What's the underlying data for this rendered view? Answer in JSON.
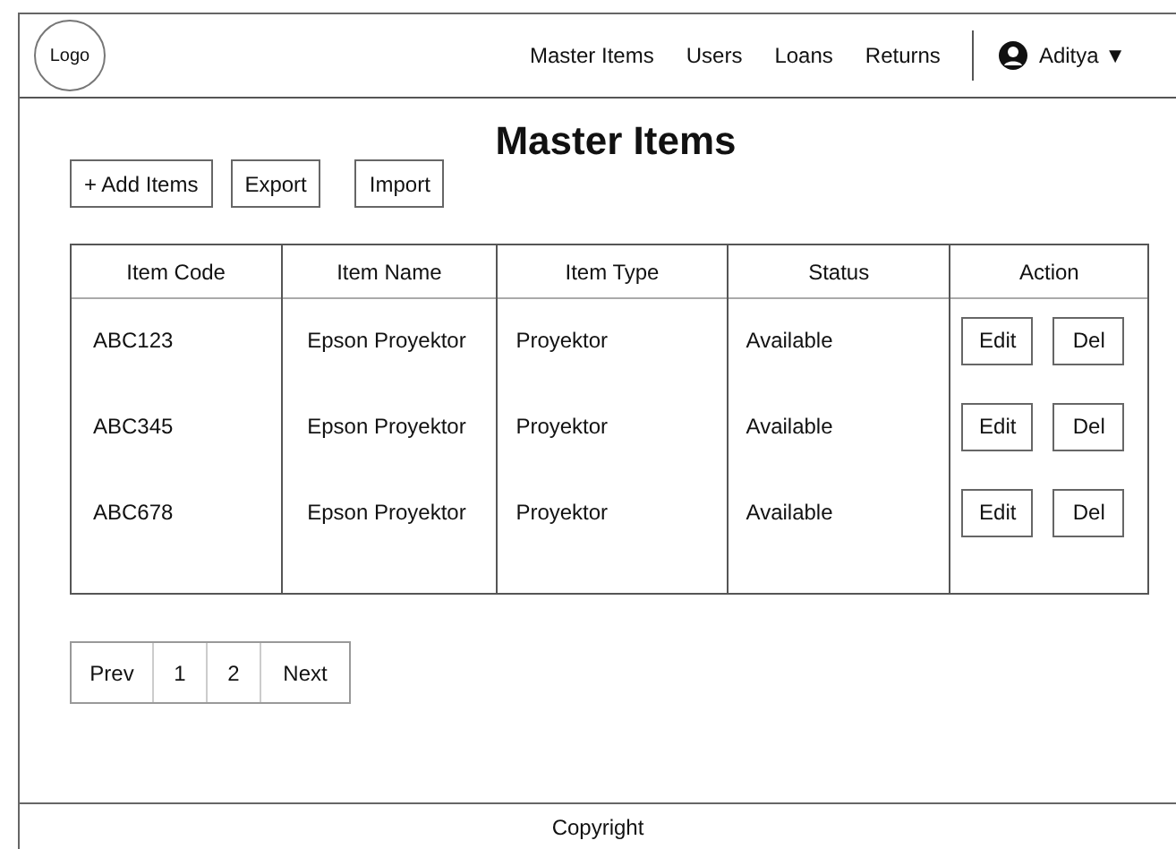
{
  "header": {
    "logo": "Logo",
    "nav": [
      "Master Items",
      "Users",
      "Loans",
      "Returns"
    ],
    "user": {
      "name": "Aditya",
      "caret": "▼"
    }
  },
  "page_title": "Master Items",
  "toolbar": [
    "+ Add Items",
    "Export",
    "Import"
  ],
  "table": {
    "columns": [
      "Item Code",
      "Item Name",
      "Item Type",
      "Status",
      "Action"
    ],
    "rows": [
      {
        "code": "ABC123",
        "name": "Epson Proyektor",
        "type": "Proyektor",
        "status": "Available",
        "actions": [
          "Edit",
          "Del"
        ]
      },
      {
        "code": "ABC345",
        "name": "Epson Proyektor",
        "type": "Proyektor",
        "status": "Available",
        "actions": [
          "Edit",
          "Del"
        ]
      },
      {
        "code": "ABC678",
        "name": "Epson Proyektor",
        "type": "Proyektor",
        "status": "Available",
        "actions": [
          "Edit",
          "Del"
        ]
      }
    ]
  },
  "pagination": [
    "Prev",
    "1",
    "2",
    "Next"
  ],
  "footer": "Copyright"
}
